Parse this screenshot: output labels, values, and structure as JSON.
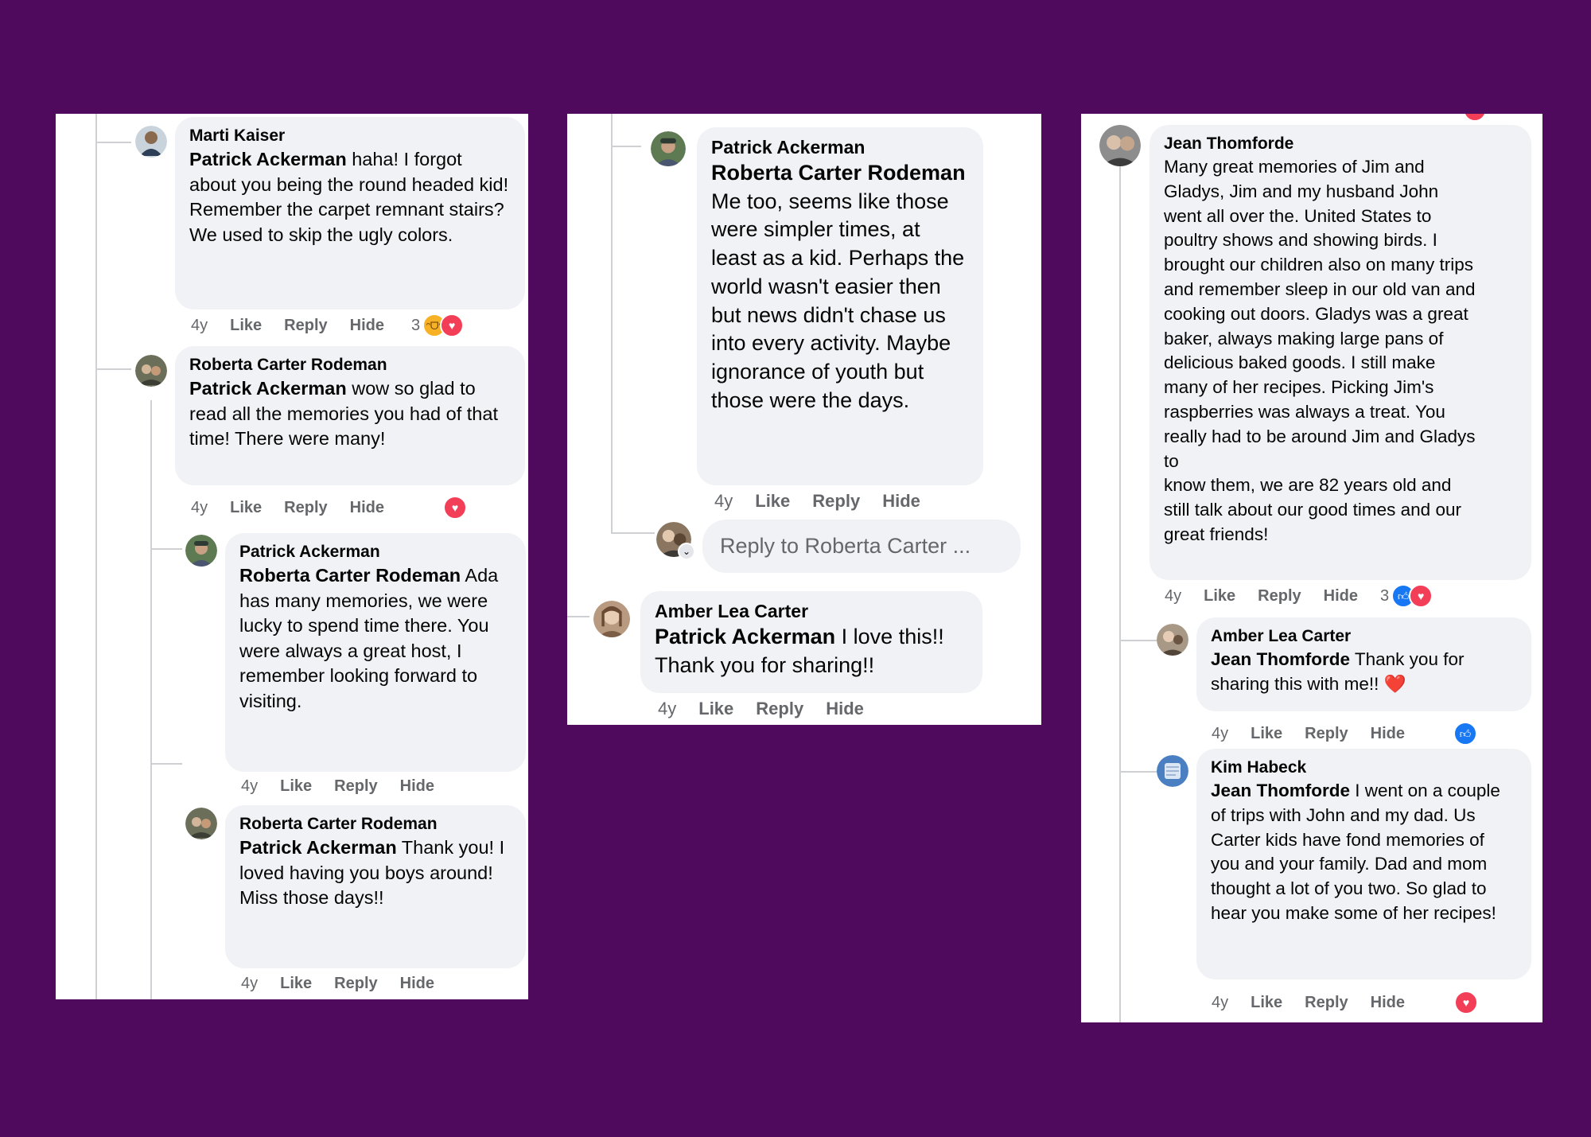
{
  "colors": {
    "background": "#4f0a5e",
    "bubble": "#f0f2f5",
    "heart": "#f33e58",
    "like": "#1877f2"
  },
  "panel1": {
    "c1": {
      "author": "Marti Kaiser",
      "mention": "Patrick Ackerman",
      "text": "haha! I forgot about you being the round headed kid! Remember the carpet remnant stairs? We used to skip the ugly colors.",
      "time": "4y",
      "like": "Like",
      "reply": "Reply",
      "hide": "Hide",
      "reaction_count": "3",
      "reaction_icons": [
        "haha-icon",
        "heart-icon"
      ]
    },
    "c2": {
      "author": "Roberta Carter Rodeman",
      "mention": "Patrick Ackerman",
      "text": "wow so glad to read all the memories you had of that time! There were many!",
      "time": "4y",
      "like": "Like",
      "reply": "Reply",
      "hide": "Hide",
      "reaction_icons": [
        "heart-icon"
      ]
    },
    "c3": {
      "author": "Patrick Ackerman",
      "mention": "Roberta Carter Rodeman",
      "text": "Ada has many memories, we were lucky to spend time there. You were always a great host, I remember looking forward to visiting.",
      "time": "4y",
      "like": "Like",
      "reply": "Reply",
      "hide": "Hide"
    },
    "c4": {
      "author": "Roberta Carter Rodeman",
      "mention": "Patrick Ackerman",
      "text": "Thank you! I loved having you boys around! Miss those days!!",
      "time": "4y",
      "like": "Like",
      "reply": "Reply",
      "hide": "Hide"
    }
  },
  "panel2": {
    "c1": {
      "author": "Patrick Ackerman",
      "mention": "Roberta Carter Rodeman",
      "text": "Me too, seems like those were simpler times, at least as a kid. Perhaps the world wasn't easier then but news didn't chase us into every activity. Maybe ignorance of youth but those were the days.",
      "time": "4y",
      "like": "Like",
      "reply": "Reply",
      "hide": "Hide"
    },
    "reply_placeholder": "Reply to Roberta Carter ...",
    "c2": {
      "author": "Amber Lea Carter",
      "mention": "Patrick Ackerman",
      "text": "I love this!! Thank you for sharing!!",
      "time": "4y",
      "like": "Like",
      "reply": "Reply",
      "hide": "Hide"
    }
  },
  "panel3": {
    "c1": {
      "author": "Jean Thomforde",
      "text_a": "Many great memories of Jim and Gladys, Jim and my husband John went all over the. United States to poultry shows and showing birds. I brought our children also on many trips and remember sleep in our old van and cooking out doors. Gladys was a great baker, always making large pans of delicious baked goods. I still make many of her recipes. Picking Jim's raspberries was always a treat. You really had to be around Jim and Gladys to",
      "text_b": "know them, we are 82 years old and still talk about our good times and our great friends!",
      "time": "4y",
      "like": "Like",
      "reply": "Reply",
      "hide": "Hide",
      "reaction_count": "3",
      "reaction_icons": [
        "like-icon",
        "heart-icon"
      ]
    },
    "c2": {
      "author": "Amber Lea Carter",
      "mention": "Jean Thomforde",
      "text": "Thank you for sharing this with me!!",
      "emoji": "❤️",
      "time": "4y",
      "like": "Like",
      "reply": "Reply",
      "hide": "Hide",
      "reaction_icons": [
        "like-icon"
      ]
    },
    "c3": {
      "author": "Kim Habeck",
      "mention": "Jean Thomforde",
      "text": "I went on a couple of trips with John and my dad. Us Carter kids have fond memories of you and your family. Dad and mom thought a lot of you two. So glad to hear you make some of her recipes!",
      "time": "4y",
      "like": "Like",
      "reply": "Reply",
      "hide": "Hide",
      "reaction_icons": [
        "heart-icon"
      ]
    }
  }
}
